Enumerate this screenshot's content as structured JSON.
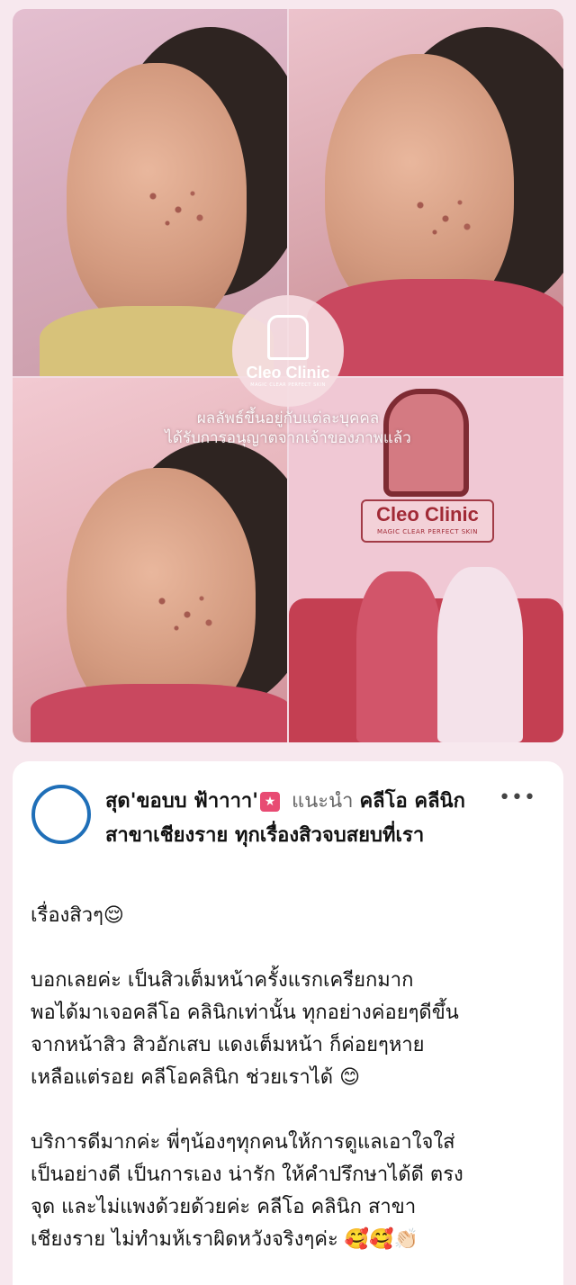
{
  "collage": {
    "logo": {
      "name": "Cleo Clinic",
      "tagline": "MAGIC CLEAR PERFECT SKIN"
    },
    "watermark_line1": "ผลลัพธ์ขึ้นอยู่กับแต่ละบุคคล",
    "watermark_line2": "ได้รับการอนุญาตจากเจ้าของภาพแล้ว",
    "wall_sign": {
      "name": "Cleo Clinic",
      "tagline": "MAGIC CLEAR PERFECT SKIN"
    }
  },
  "post": {
    "author": "สุด'ขอบบ ฟ้าาาา'",
    "author_badge": "★",
    "verb": "แนะนำ",
    "page_name": "คลีโอ คลีนิก สาขาเชียงราย ทุกเรื่องสิวจบสยบที่เรา",
    "more_label": "•••",
    "paragraphs": [
      "เรื่องสิวๆ😌",
      "บอกเลยค่ะ เป็นสิวเต็มหน้าครั้งแรกเครียกมาก\nพอได้มาเจอคลีโอ คลินิกเท่านั้น ทุกอย่างค่อยๆดีขึ้น\nจากหน้าสิว สิวอักเสบ แดงเต็มหน้า ก็ค่อยๆหาย\nเหลือแต่รอย คลีโอคลินิก ช่วยเราได้ 😊",
      "บริการดีมากค่ะ พี่ๆน้องๆทุกคนให้การดูแลเอาใจใส่\nเป็นอย่างดี เป็นการเอง น่ารัก ให้คำปรึกษาได้ดี ตรง\nจุด และไม่แพงด้วยด้วยค่ะ คลีโอ คลินิก สาขา\nเชียงราย ไม่ทำมห้เราผิดหวังจริงๆค่ะ 🥰🥰👏🏻"
    ]
  },
  "colors": {
    "accent_blue": "#1f6fb8",
    "badge_pink": "#e84b73",
    "background": "#f7e8ee"
  }
}
